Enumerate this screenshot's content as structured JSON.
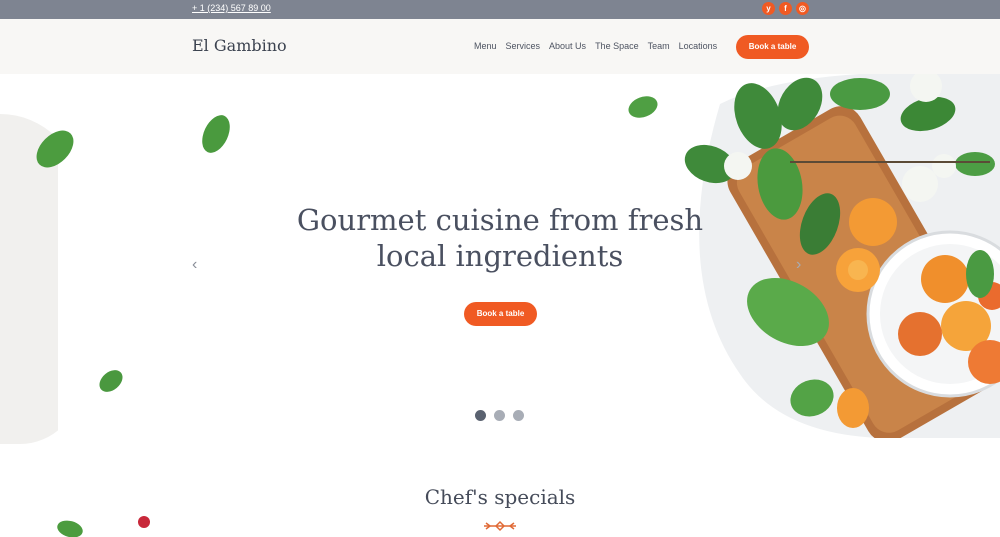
{
  "topbar": {
    "phone": "+ 1 (234) 567 89 00",
    "socials": [
      {
        "name": "twitter",
        "glyph": "y"
      },
      {
        "name": "facebook",
        "glyph": "f"
      },
      {
        "name": "instagram",
        "glyph": "◎"
      }
    ]
  },
  "header": {
    "logo": "El Gambino",
    "nav": [
      "Menu",
      "Services",
      "About Us",
      "The Space",
      "Team",
      "Locations"
    ],
    "cta": "Book a table"
  },
  "hero": {
    "title_line1": "Gourmet cuisine from fresh",
    "title_line2": "local ingredients",
    "cta": "Book a table",
    "prev_glyph": "‹",
    "next_glyph": "›",
    "slides_total": 3,
    "active_slide": 1
  },
  "specials": {
    "title": "Chef's specials"
  },
  "colors": {
    "accent": "#f05a23",
    "topbar": "#7e8491",
    "header_bg": "#f8f7f5"
  }
}
